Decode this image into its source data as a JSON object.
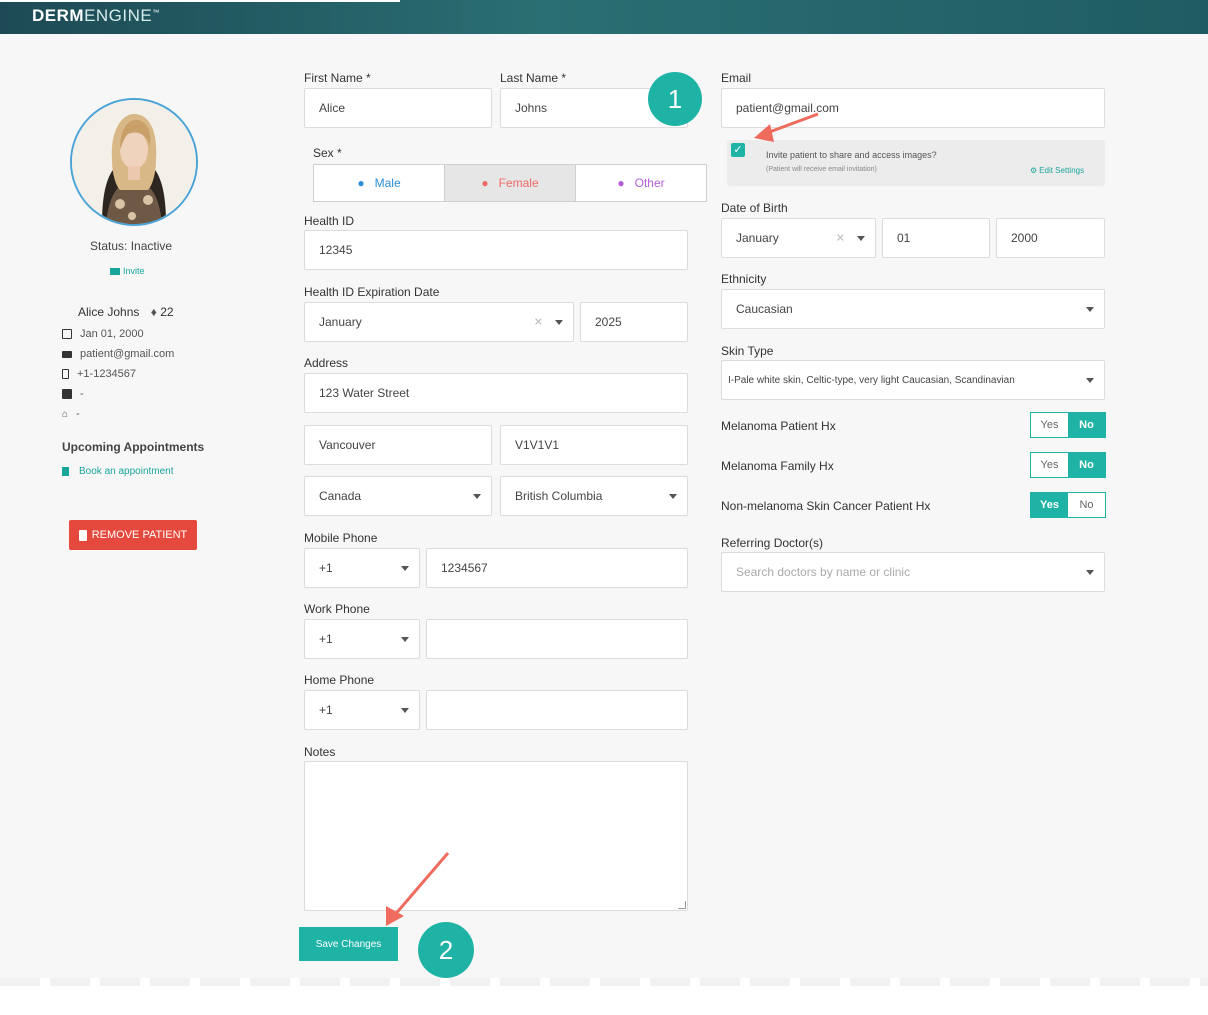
{
  "header": {
    "logo_bold": "DERM",
    "logo_light": "ENGINE",
    "logo_tm": "™"
  },
  "profile": {
    "status": "Status: Inactive",
    "invite_link": "Invite",
    "name": "Alice Johns",
    "age": "22",
    "dob": "Jan 01, 2000",
    "email": "patient@gmail.com",
    "phone": "+1-1234567",
    "work": "-",
    "home": "-",
    "appointments_heading": "Upcoming Appointments",
    "book_link": "Book an appointment",
    "remove_button": "REMOVE PATIENT"
  },
  "form": {
    "first_name": {
      "label": "First Name *",
      "value": "Alice"
    },
    "last_name": {
      "label": "Last Name *",
      "value": "Johns"
    },
    "sex": {
      "label": "Sex *",
      "options": [
        "Male",
        "Female",
        "Other"
      ],
      "selected": "Female"
    },
    "health_id": {
      "label": "Health ID",
      "value": "12345"
    },
    "health_exp": {
      "label": "Health ID Expiration Date",
      "month": "January",
      "year": "2025"
    },
    "address": {
      "label": "Address",
      "street": "123 Water Street",
      "city": "Vancouver",
      "postal": "V1V1V1",
      "country": "Canada",
      "province": "British Columbia"
    },
    "mobile": {
      "label": "Mobile Phone",
      "code": "+1",
      "number": "1234567"
    },
    "work_phone": {
      "label": "Work Phone",
      "code": "+1",
      "number": ""
    },
    "home_phone": {
      "label": "Home Phone",
      "code": "+1",
      "number": ""
    },
    "notes": {
      "label": "Notes",
      "value": ""
    },
    "save_button": "Save Changes",
    "email": {
      "label": "Email",
      "value": "patient@gmail.com"
    },
    "invite": {
      "checked": true,
      "text": "Invite patient to share and access images?",
      "subtext": "(Patient will receive email invitation)",
      "edit_settings": "Edit Settings"
    },
    "dob": {
      "label": "Date of Birth",
      "month": "January",
      "day": "01",
      "year": "2000"
    },
    "ethnicity": {
      "label": "Ethnicity",
      "value": "Caucasian"
    },
    "skin_type": {
      "label": "Skin Type",
      "value": "I-Pale white skin, Celtic-type, very light Caucasian, Scandinavian"
    },
    "melanoma_patient": {
      "label": "Melanoma Patient Hx",
      "selected": "No"
    },
    "melanoma_family": {
      "label": "Melanoma Family Hx",
      "selected": "No"
    },
    "non_melanoma": {
      "label": "Non-melanoma Skin Cancer Patient Hx",
      "selected": "Yes"
    },
    "yes": "Yes",
    "no": "No",
    "referring": {
      "label": "Referring Doctor(s)",
      "placeholder": "Search doctors by name or clinic"
    }
  },
  "annotations": {
    "step1": "1",
    "step2": "2"
  },
  "colors": {
    "accent": "#1fb3a6",
    "danger": "#e5483c",
    "male": "#2b8fd6",
    "female": "#f06a66",
    "other": "#b25cd6",
    "header": "#1f5c63"
  }
}
